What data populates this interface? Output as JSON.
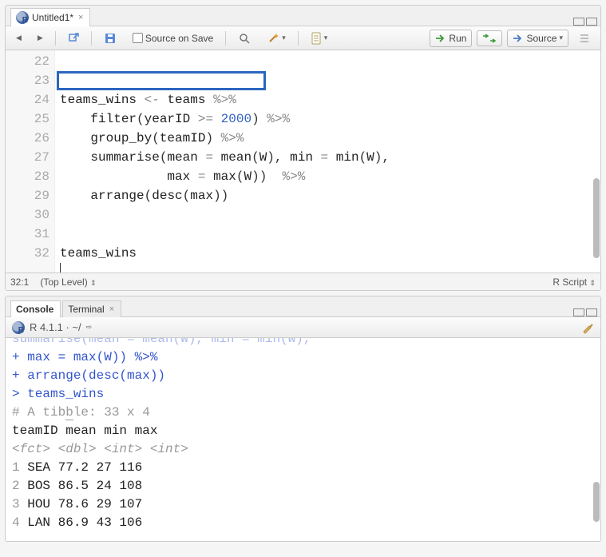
{
  "tab": {
    "title": "Untitled1*"
  },
  "toolbar": {
    "source_on_save": "Source on Save",
    "run": "Run",
    "source": "Source"
  },
  "status": {
    "position": "32:1",
    "scope": "(Top Level)",
    "mode": "R Script"
  },
  "code_lines": [
    {
      "n": 22,
      "text": ""
    },
    {
      "n": 23,
      "text": "teams_wins <- teams %>%"
    },
    {
      "n": 24,
      "text": "    filter(yearID >= 2000) %>%"
    },
    {
      "n": 25,
      "text": "    group_by(teamID) %>%"
    },
    {
      "n": 26,
      "text": "    summarise(mean = mean(W), min = min(W),"
    },
    {
      "n": 27,
      "text": "              max = max(W))  %>%"
    },
    {
      "n": 28,
      "text": "    arrange(desc(max))"
    },
    {
      "n": 29,
      "text": ""
    },
    {
      "n": 30,
      "text": ""
    },
    {
      "n": 31,
      "text": "teams_wins"
    },
    {
      "n": 32,
      "text": ""
    }
  ],
  "console_tabs": {
    "console": "Console",
    "terminal": "Terminal"
  },
  "console_info": "R 4.1.1 · ~/",
  "console_lines": [
    {
      "prefix": "+",
      "text": "              max = max(W)) %>%",
      "cls": "c-blue"
    },
    {
      "prefix": "+",
      "text": "    arrange(desc(max))",
      "cls": "c-blue"
    },
    {
      "prefix": ">",
      "text": " teams_wins",
      "cls": "c-blue"
    },
    {
      "prefix": "#",
      "text": " A tibble: 33 x 4",
      "cls": "c-gray"
    },
    {
      "prefix": " ",
      "text": "   teamID  mean   min   max",
      "cls": "c-black"
    },
    {
      "prefix": " ",
      "text": "   <fct>  <dbl> <int> <int>",
      "cls": "c-gray",
      "italic": true
    },
    {
      "prefix": " ",
      "text": " 1 SEA     77.2    27   116",
      "cls": "c-black",
      "grayn": true
    },
    {
      "prefix": " ",
      "text": " 2 BOS     86.5    24   108",
      "cls": "c-black",
      "grayn": true
    },
    {
      "prefix": " ",
      "text": " 3 HOU     78.6    29   107",
      "cls": "c-black",
      "grayn": true
    },
    {
      "prefix": " ",
      "text": " 4 LAN     86.9    43   106",
      "cls": "c-black",
      "grayn": true
    }
  ],
  "chart_data": {
    "type": "table",
    "title": "A tibble: 33 x 4",
    "columns": [
      "teamID",
      "mean",
      "min",
      "max"
    ],
    "column_types": [
      "<fct>",
      "<dbl>",
      "<int>",
      "<int>"
    ],
    "rows": [
      [
        "SEA",
        77.2,
        27,
        116
      ],
      [
        "BOS",
        86.5,
        24,
        108
      ],
      [
        "HOU",
        78.6,
        29,
        107
      ],
      [
        "LAN",
        86.9,
        43,
        106
      ]
    ]
  }
}
